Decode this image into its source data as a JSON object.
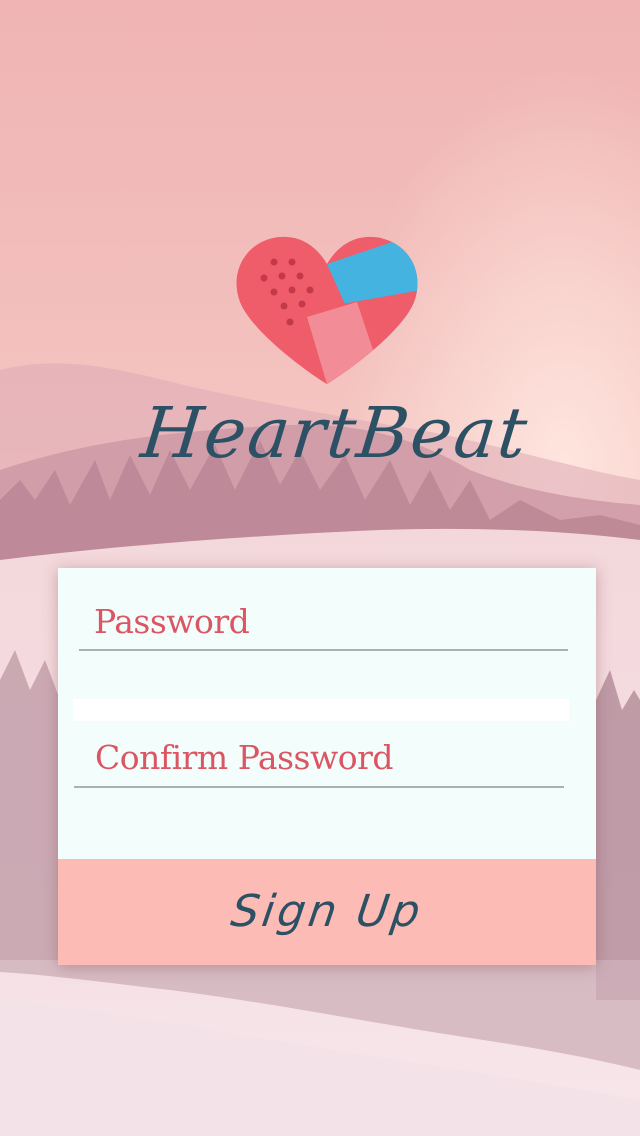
{
  "app": {
    "title": "HeartBeat",
    "logo_icon": "bandage-heart-icon"
  },
  "form": {
    "password_label": "Password",
    "confirm_password_label": "Confirm Password",
    "signup_label": "Sign Up"
  },
  "colors": {
    "title": "#2c5164",
    "label": "#db5563",
    "button": "#fdbbb5",
    "card": "#f3fdfb",
    "heart_red": "#ef5c6a",
    "heart_blue": "#45b3e0"
  },
  "background": "snowy-mountain-forest-sunset"
}
